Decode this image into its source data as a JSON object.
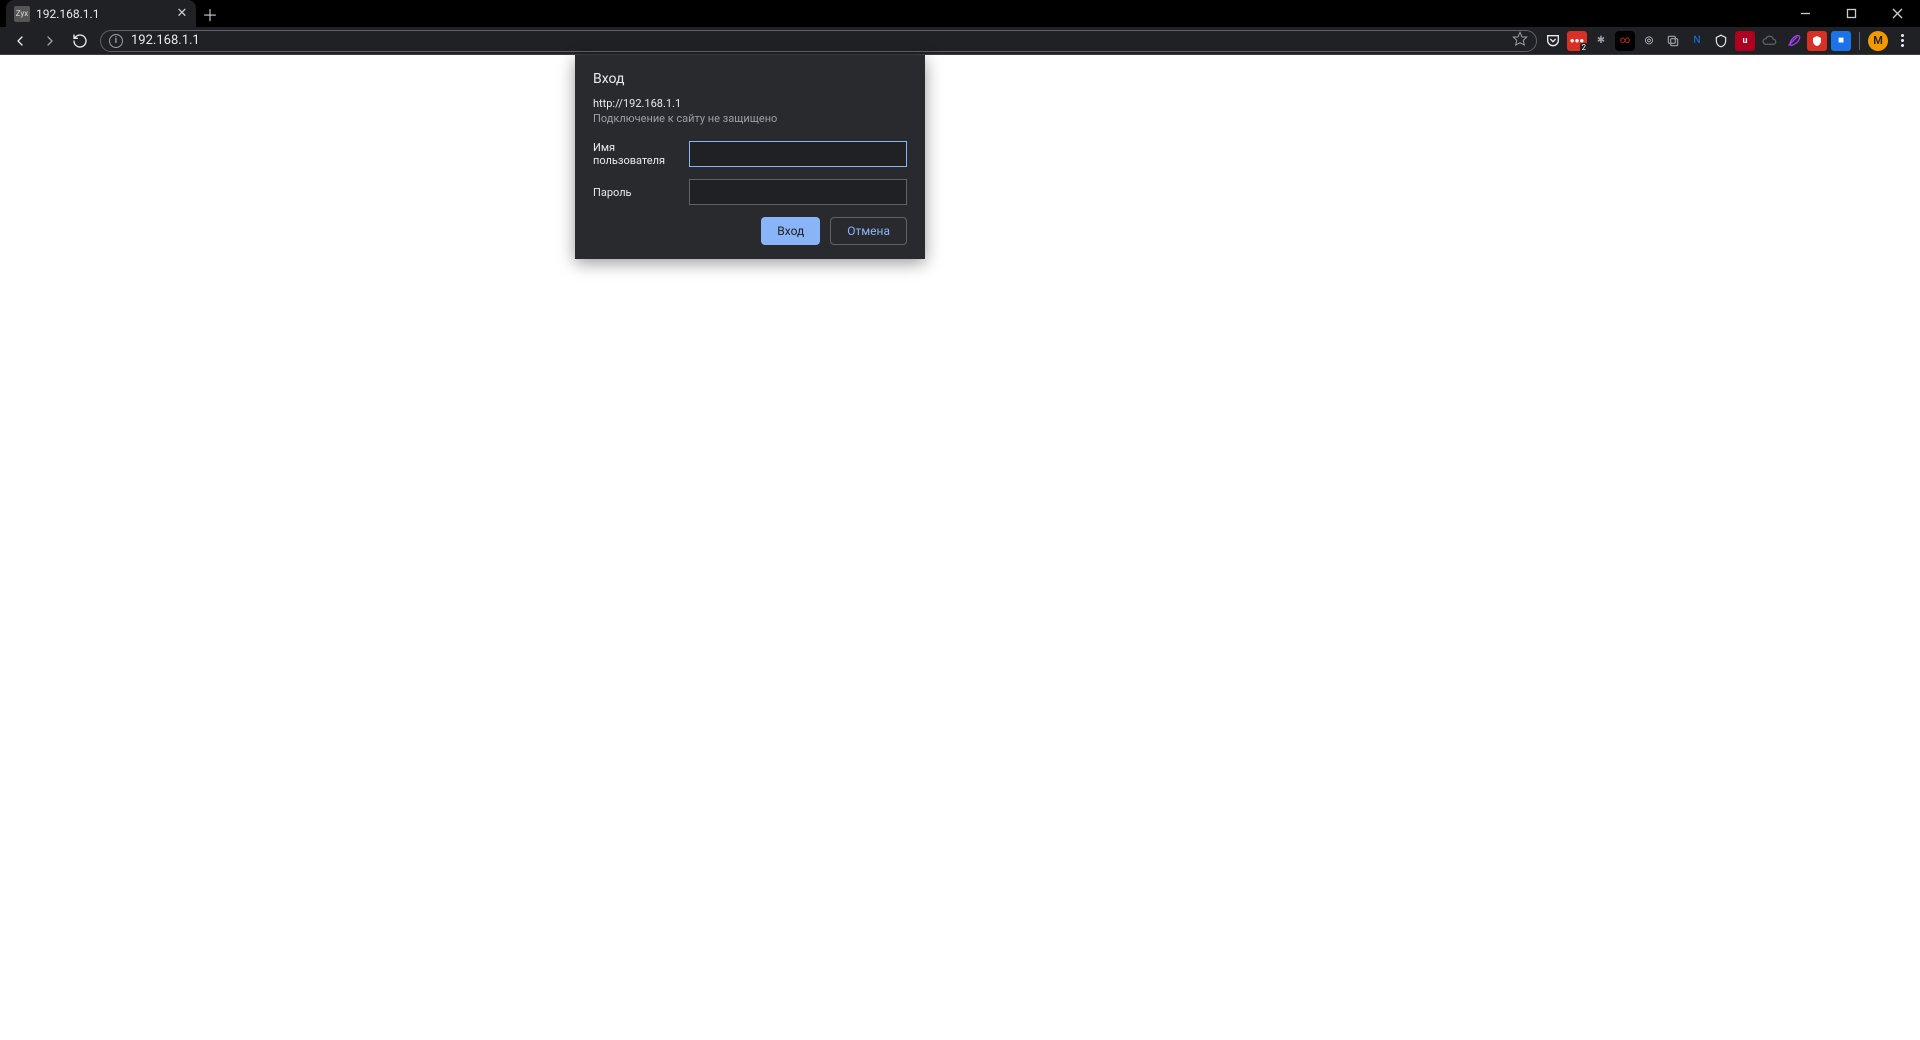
{
  "tab": {
    "title": "192.168.1.1",
    "favicon_text": "Zyx"
  },
  "toolbar": {
    "url": "192.168.1.1"
  },
  "extensions": {
    "badge1_count": "2",
    "avatar_letter": "M"
  },
  "auth": {
    "title": "Вход",
    "url": "http://192.168.1.1",
    "warning": "Подключение к сайту не защищено",
    "username_label": "Имя пользователя",
    "password_label": "Пароль",
    "username_value": "",
    "password_value": "",
    "login_label": "Вход",
    "cancel_label": "Отмена"
  }
}
